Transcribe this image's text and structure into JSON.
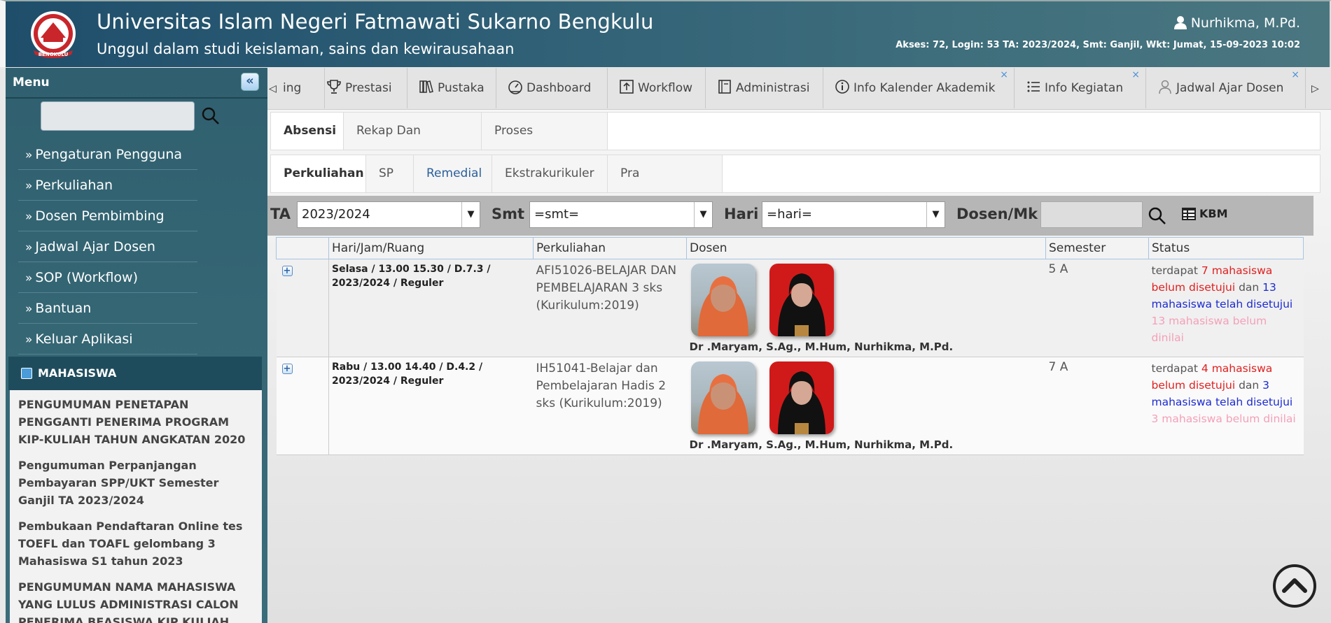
{
  "header": {
    "title": "Universitas Islam Negeri Fatmawati Sukarno Bengkulu",
    "subtitle": "Unggul dalam studi keislaman, sains dan kewirausahaan",
    "logo_text": "BENGKULU",
    "user_name": "Nurhikma, M.Pd.",
    "access_info": "Akses: 72, Login: 53 TA: 2023/2024, Smt: Ganjil, Wkt: Jumat, 15-09-2023 10:02"
  },
  "sidebar": {
    "menu_title": "Menu",
    "search_placeholder": "",
    "items": [
      {
        "label": "Pengaturan Pengguna"
      },
      {
        "label": "Perkuliahan"
      },
      {
        "label": "Dosen Pembimbing"
      },
      {
        "label": "Jadwal Ajar Dosen"
      },
      {
        "label": "SOP (Workflow)"
      },
      {
        "label": "Bantuan"
      },
      {
        "label": "Keluar Aplikasi"
      }
    ],
    "section_title": "MAHASISWA",
    "news": [
      "PENGUMUMAN PENETAPAN PENGGANTI PENERIMA PROGRAM KIP-KULIAH TAHUN ANGKATAN 2020",
      "Pengumuman Perpanjangan Pembayaran SPP/UKT Semester Ganjil TA 2023/2024",
      "Pembukaan Pendaftaran Online tes TOEFL dan TOAFL gelombang 3 Mahasiswa S1 tahun 2023",
      "PENGUMUMAN NAMA MAHASISWA YANG LULUS ADMINISTRASI CALON PENERIMA BEASISWA KIP KULIAH"
    ]
  },
  "tabs": [
    {
      "label": "ing",
      "icon": "none"
    },
    {
      "label": "Prestasi",
      "icon": "trophy-icon"
    },
    {
      "label": "Pustaka",
      "icon": "books-icon"
    },
    {
      "label": "Dashboard",
      "icon": "gauge-icon"
    },
    {
      "label": "Workflow",
      "icon": "upload-icon"
    },
    {
      "label": "Administrasi",
      "icon": "book-icon"
    },
    {
      "label": "Info Kalender Akademik",
      "icon": "info-icon",
      "closable": true
    },
    {
      "label": "Info Kegiatan",
      "icon": "list-icon",
      "closable": true
    },
    {
      "label": "Jadwal Ajar Dosen",
      "icon": "user-icon",
      "closable": true
    }
  ],
  "subtabs_level1": [
    "Absensi",
    "Rekap Dan Laporan",
    "Proses Kehadiran"
  ],
  "subtabs_level2": [
    "Perkuliahan",
    "SP",
    "Remedial",
    "Ekstrakurikuler",
    "Pra Perkuliahan"
  ],
  "filters": {
    "ta_label": "TA :",
    "ta_value": "2023/2024",
    "smt_label": "Smt :",
    "smt_value": "=smt=",
    "hari_label": "Hari :",
    "hari_value": "=hari=",
    "dosen_label": "Dosen/Mk :",
    "dosen_value": "",
    "kbm_label": "KBM"
  },
  "table": {
    "columns": [
      "",
      "Hari/Jam/Ruang",
      "Perkuliahan",
      "Dosen",
      "Semester",
      "Status"
    ],
    "rows": [
      {
        "hari": "Selasa / 13.00 15.30 / D.7.3 / 2023/2024 / Reguler",
        "perkuliahan": "AFI51026-BELAJAR DAN PEMBELAJARAN 3 sks (Kurikulum:2019)",
        "dosen": "Dr .Maryam, S.Ag., M.Hum, Nurhikma, M.Pd.",
        "semester": "5 A",
        "status": {
          "p1": "terdapat ",
          "red": "7 mahasiswa belum disetujui",
          "p2": " dan ",
          "blue": "13 mahasiswa telah disetujui",
          "pink": "13 mahasiswa belum dinilai"
        }
      },
      {
        "hari": "Rabu / 13.00 14.40 / D.4.2 / 2023/2024 / Reguler",
        "perkuliahan": "IH51041-Belajar dan Pembelajaran Hadis 2 sks (Kurikulum:2019)",
        "dosen": "Dr .Maryam, S.Ag., M.Hum, Nurhikma, M.Pd.",
        "semester": "7 A",
        "status": {
          "p1": "terdapat ",
          "red": "4 mahasiswa belum disetujui",
          "p2": " dan ",
          "blue": "3 mahasiswa telah disetujui",
          "pink": "3 mahasiswa belum dinilai"
        }
      }
    ]
  },
  "colors": {
    "header_bg": "#2d5e75",
    "sidebar_bg": "#30606f",
    "status_red": "#e02020",
    "status_blue": "#1d2bd0",
    "status_pink": "#f4a0b8"
  }
}
